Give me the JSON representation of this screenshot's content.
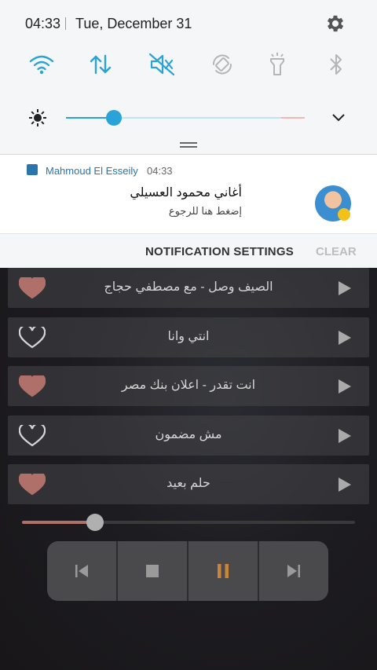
{
  "status_bar": {
    "time": "04:33",
    "date": "Tue, December 31"
  },
  "quick_settings": {
    "active_color": "#2aa4d8",
    "inactive_color": "#b5b5b5",
    "tiles": [
      {
        "icon": "wifi-icon",
        "active": true
      },
      {
        "icon": "mobile-data-icon",
        "active": true
      },
      {
        "icon": "sound-mute-icon",
        "active": true
      },
      {
        "icon": "auto-rotate-icon",
        "active": false
      },
      {
        "icon": "flashlight-icon",
        "active": false
      },
      {
        "icon": "bluetooth-icon",
        "active": false
      }
    ]
  },
  "brightness": {
    "level_percent": 20
  },
  "notification": {
    "app_name": "Mahmoud El Esseily",
    "time": "04:33",
    "title": "أغاني محمود العسيلي",
    "subtitle": "إضغط هنا للرجوع"
  },
  "actions": {
    "settings_label": "NOTIFICATION SETTINGS",
    "clear_label": "CLEAR"
  },
  "songs": [
    {
      "title": "الصيف وصل - مع مصطفي حجاج",
      "favorite": true
    },
    {
      "title": "انتي وانا",
      "favorite": false
    },
    {
      "title": "انت تقدر - اعلان بنك مصر",
      "favorite": true
    },
    {
      "title": "مش مضمون",
      "favorite": false
    },
    {
      "title": "حلم بعيد",
      "favorite": true
    }
  ],
  "player": {
    "progress_percent": 22,
    "accent": "#c8843c"
  }
}
